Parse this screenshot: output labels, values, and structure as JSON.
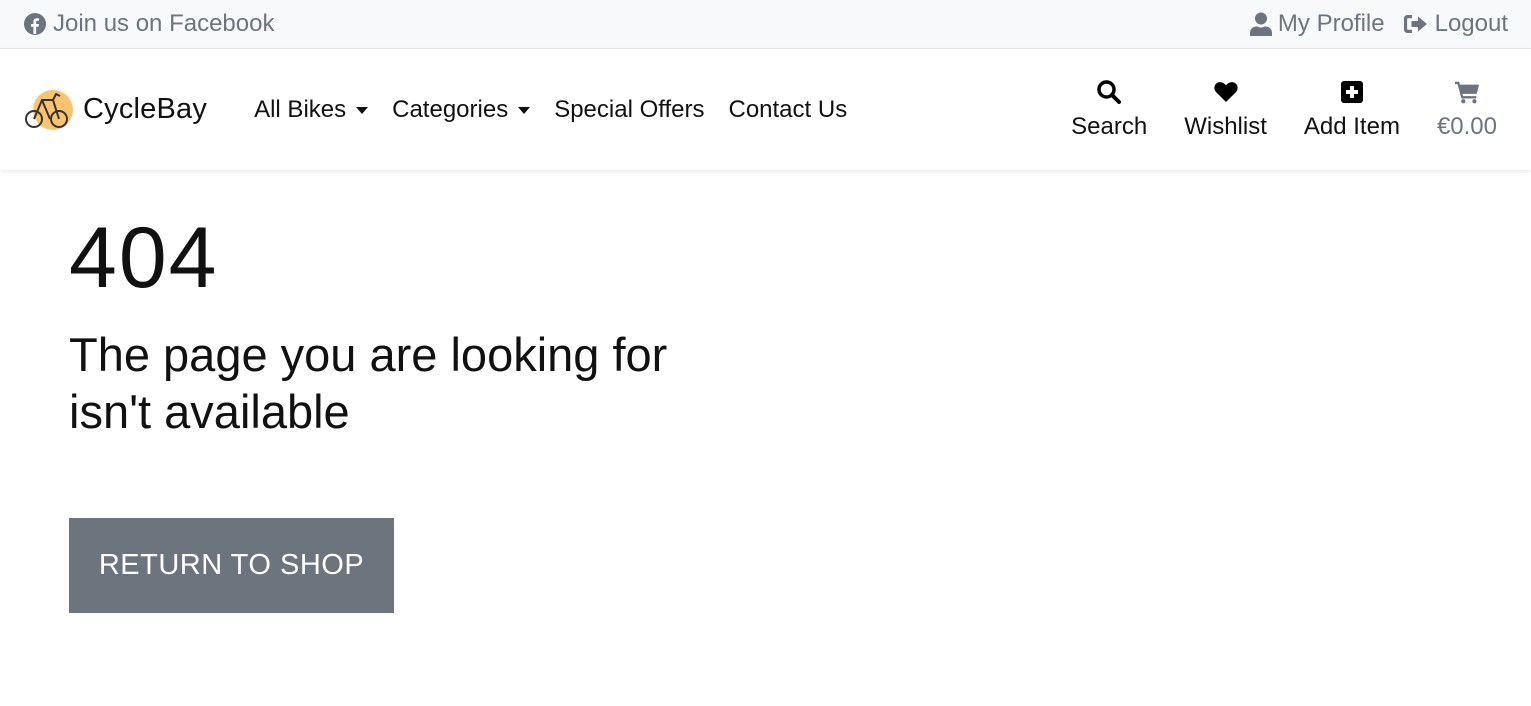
{
  "topbar": {
    "facebook": {
      "icon": "facebook-icon",
      "label": "Join us on Facebook"
    },
    "profile": {
      "icon": "user-icon",
      "label": "My Profile"
    },
    "logout": {
      "icon": "sign-out-icon",
      "label": "Logout"
    }
  },
  "navbar": {
    "brand": {
      "name": "CycleBay",
      "logo_icon": "bicycle-logo-icon",
      "logo_color": "#f9c46b"
    },
    "links": [
      {
        "label": "All Bikes",
        "dropdown": true
      },
      {
        "label": "Categories",
        "dropdown": true
      },
      {
        "label": "Special Offers",
        "dropdown": false
      },
      {
        "label": "Contact Us",
        "dropdown": false
      }
    ],
    "actions": [
      {
        "icon": "search-icon",
        "label": "Search"
      },
      {
        "icon": "heart-icon",
        "label": "Wishlist"
      },
      {
        "icon": "plus-square-icon",
        "label": "Add Item"
      },
      {
        "icon": "cart-icon",
        "label": "€0.00"
      }
    ]
  },
  "main": {
    "error_code": "404",
    "message": "The page you are looking for isn't available",
    "button_label": "RETURN TO SHOP",
    "button_color": "#6c757d"
  }
}
